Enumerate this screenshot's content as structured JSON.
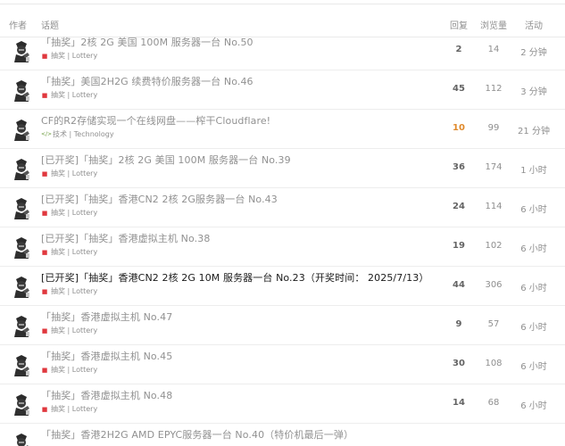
{
  "header": {
    "author": "作者",
    "topic": "话题",
    "replies": "回复",
    "views": "浏览量",
    "activity": "活动"
  },
  "colors": {
    "hot_replies": "#e08a2c",
    "lottery_icon": "#e0383e",
    "tech_icon": "#6c9b3d"
  },
  "topics": [
    {
      "title": "「抽奖」2核 2G 美国 100M 服务器一台 No.50",
      "category": "抽奖 | Lottery",
      "category_icon": "gift-icon",
      "replies": "2",
      "views": "14",
      "activity": "2 分钟",
      "unread": false,
      "hot": false
    },
    {
      "title": "「抽奖」美国2H2G 续费特价服务器一台 No.46",
      "category": "抽奖 | Lottery",
      "category_icon": "gift-icon",
      "replies": "45",
      "views": "112",
      "activity": "3 分钟",
      "unread": false,
      "hot": false
    },
    {
      "title": "CF的R2存储实现一个在线网盘——榨干Cloudflare!",
      "category": "技术 | Technology",
      "category_icon": "code-icon",
      "replies": "10",
      "views": "99",
      "activity": "21 分钟",
      "unread": false,
      "hot": true
    },
    {
      "title": "[已开奖]「抽奖」2核 2G 美国 100M 服务器一台 No.39",
      "category": "抽奖 | Lottery",
      "category_icon": "gift-icon",
      "replies": "36",
      "views": "174",
      "activity": "1 小时",
      "unread": false,
      "hot": false
    },
    {
      "title": "[已开奖]「抽奖」香港CN2 2核 2G服务器一台 No.43",
      "category": "抽奖 | Lottery",
      "category_icon": "gift-icon",
      "replies": "24",
      "views": "114",
      "activity": "6 小时",
      "unread": false,
      "hot": false
    },
    {
      "title": "[已开奖]「抽奖」香港虚拟主机 No.38",
      "category": "抽奖 | Lottery",
      "category_icon": "gift-icon",
      "replies": "19",
      "views": "102",
      "activity": "6 小时",
      "unread": false,
      "hot": false
    },
    {
      "title": "[已开奖]「抽奖」香港CN2 2核 2G 10M 服务器一台 No.23（开奖时间： 2025/7/13）",
      "category": "抽奖 | Lottery",
      "category_icon": "gift-icon",
      "replies": "44",
      "views": "306",
      "activity": "6 小时",
      "unread": true,
      "hot": false
    },
    {
      "title": "「抽奖」香港虚拟主机 No.47",
      "category": "抽奖 | Lottery",
      "category_icon": "gift-icon",
      "replies": "9",
      "views": "57",
      "activity": "6 小时",
      "unread": false,
      "hot": false
    },
    {
      "title": "「抽奖」香港虚拟主机 No.45",
      "category": "抽奖 | Lottery",
      "category_icon": "gift-icon",
      "replies": "30",
      "views": "108",
      "activity": "6 小时",
      "unread": false,
      "hot": false
    },
    {
      "title": "「抽奖」香港虚拟主机 No.48",
      "category": "抽奖 | Lottery",
      "category_icon": "gift-icon",
      "replies": "14",
      "views": "68",
      "activity": "6 小时",
      "unread": false,
      "hot": false
    },
    {
      "title": "「抽奖」香港2H2G AMD EPYC服务器一台 No.40（特价机最后一弹）",
      "category": "",
      "category_icon": "",
      "replies": "",
      "views": "",
      "activity": "",
      "unread": false,
      "hot": false
    }
  ]
}
